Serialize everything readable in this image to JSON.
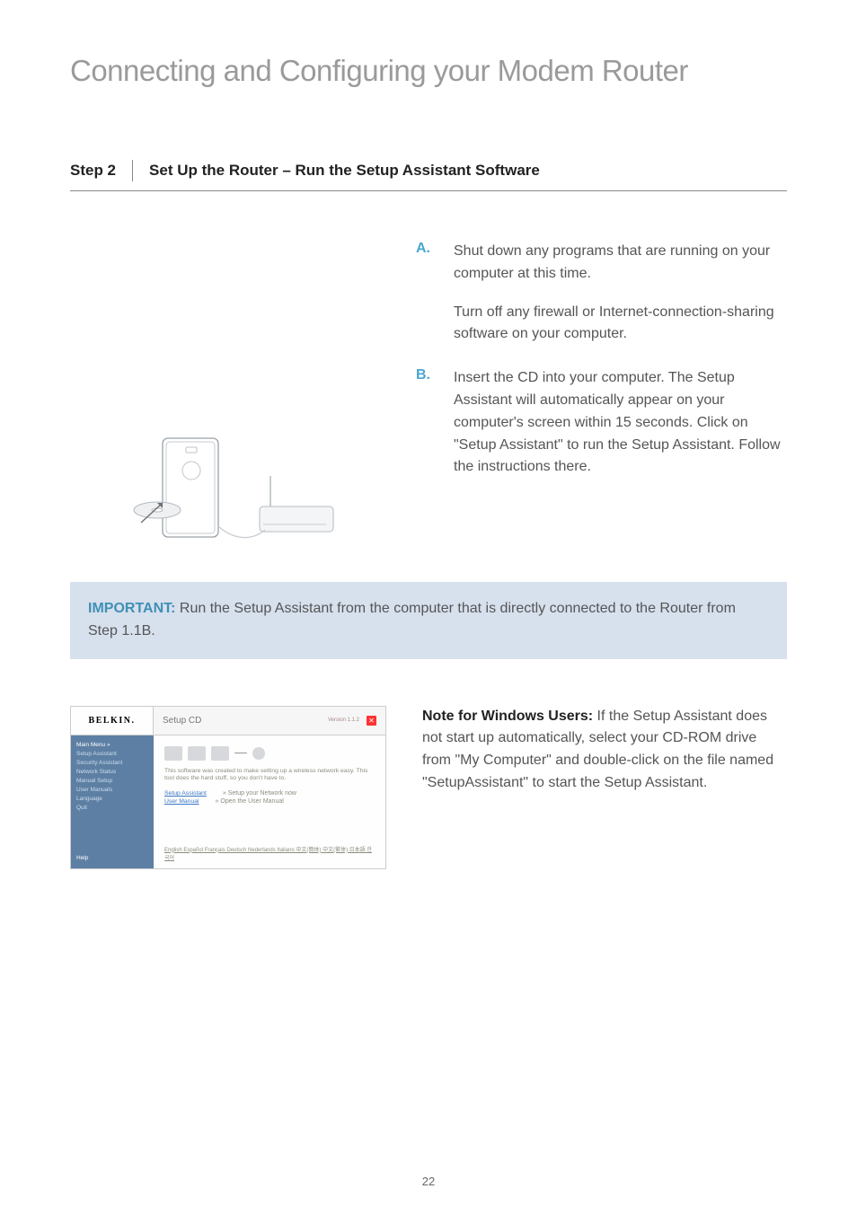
{
  "page_title": "Connecting and Configuring your Modem Router",
  "page_number": "22",
  "step": {
    "label": "Step 2",
    "title": "Set Up the Router – Run the Setup Assistant Software"
  },
  "items": {
    "a": {
      "letter": "A.",
      "p1": "Shut down any programs that are running on your computer at this time.",
      "p2": "Turn off any firewall or Internet-connection-sharing software on your computer."
    },
    "b": {
      "letter": "B.",
      "p1": "Insert the CD into your computer. The Setup Assistant will automatically appear on your computer's screen within 15 seconds. Click on \"Setup Assistant\" to run the Setup Assistant. Follow the instructions there."
    }
  },
  "important": {
    "label": "IMPORTANT:",
    "text": " Run the Setup Assistant from the computer that is directly connected to the Router from Step 1.1B."
  },
  "note": {
    "label": "Note for Windows Users:",
    "text": " If the Setup Assistant does not start up automatically, select your CD-ROM drive from \"My Computer\" and double-click on the file named \"SetupAssistant\" to start the Setup Assistant."
  },
  "screenshot": {
    "logo": "BELKIN.",
    "title": "Setup CD",
    "version": "Version 1.1.2",
    "sidebar": {
      "main_menu": "Main Menu  »",
      "items": [
        "Setup Assistant",
        "Security Assistant",
        "Network Status",
        "Manual Setup",
        "User Manuals",
        "Language",
        "Quit"
      ],
      "help": "Help"
    },
    "desc": "This software was created to make setting up a wireless network easy. This tool does the hard stuff, so you don't have to.",
    "rows": {
      "r1": {
        "link": "Setup Assistant",
        "hint": "» Setup your Network now"
      },
      "r2": {
        "link": "User Manual",
        "hint": "» Open the User Manual"
      }
    },
    "langs": "English Español Français Deutsch Nederlands Italiano 中文(簡体) 中文(繁体) 日本語 한국어"
  }
}
